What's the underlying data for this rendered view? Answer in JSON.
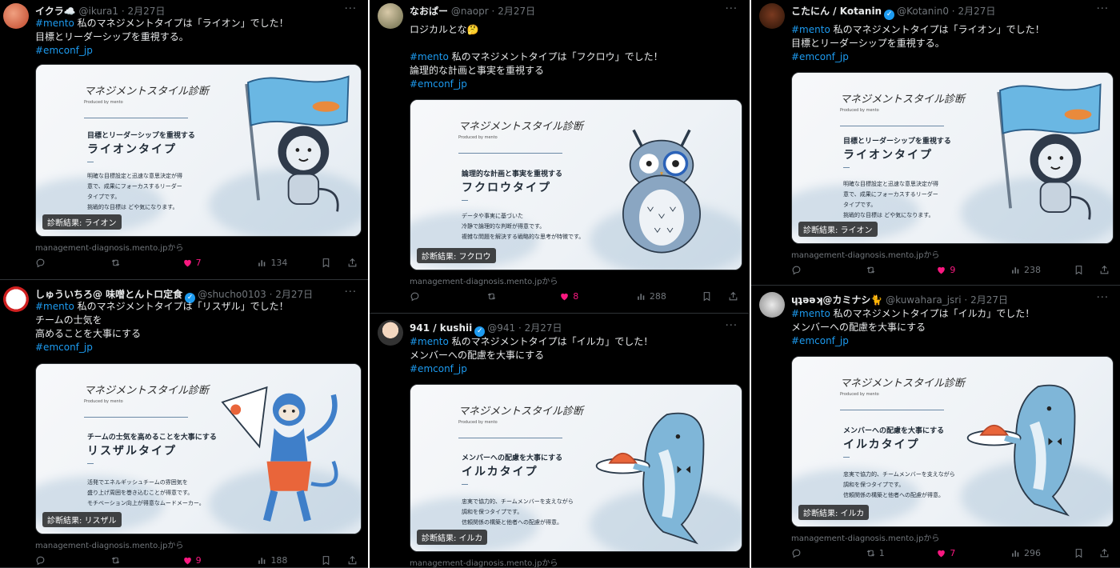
{
  "col1": [
    {
      "name": "イクラ☁️",
      "handle": "@ikura1",
      "date": "2月27日",
      "verified": false,
      "lines": [
        [
          {
            "t": "#mento",
            "h": true
          },
          {
            "t": " 私のマネジメントタイプは「ライオン」でした！",
            "h": false
          }
        ],
        [
          {
            "t": "目標とリーダーシップを重視する。",
            "h": false
          }
        ],
        [
          {
            "t": "#emconf_jp",
            "h": true
          }
        ]
      ],
      "card": {
        "logo": "マネジメントスタイル診断",
        "produced": "Produced by mento",
        "subtitle": "目標とリーダーシップを重視する",
        "type": "ライオンタイプ",
        "desc": [
          "明確な目標設定と迅速な意思決定が得",
          "意で、成果にフォーカスするリーダー",
          "タイプです。",
          "挑戦的な目標は どや気になります。"
        ],
        "badge": "診断結果: ライオン"
      },
      "link": "management-diagnosis.mento.jpから",
      "stats": {
        "reply": "",
        "retweet": "",
        "like": "7",
        "views": "134"
      }
    },
    {
      "name": "しゅういちろ@ 味噌とんトロ定食",
      "handle": "@shucho0103",
      "date": "2月27日",
      "verified": true,
      "lines": [
        [
          {
            "t": "#mento",
            "h": true
          },
          {
            "t": " 私のマネジメントタイプは「リスザル」でした！",
            "h": false
          }
        ],
        [
          {
            "t": "チームの士気を",
            "h": false
          }
        ],
        [
          {
            "t": "高めることを大事にする",
            "h": false
          }
        ],
        [
          {
            "t": "#emconf_jp",
            "h": true
          }
        ]
      ],
      "card": {
        "logo": "マネジメントスタイル診断",
        "produced": "Produced by mento",
        "subtitle": "チームの士気を高めることを大事にする",
        "type": "リスザルタイプ",
        "desc": [
          "活発でエネルギッシュチームの雰囲気を",
          "盛り上げ周囲を巻き込むことが得意です。",
          "モチベーション向上が得意なムードメーカー。"
        ],
        "badge": "診断結果: リスザル"
      },
      "link": "management-diagnosis.mento.jpから",
      "stats": {
        "reply": "",
        "retweet": "",
        "like": "9",
        "views": "188"
      }
    }
  ],
  "col2": [
    {
      "name": "なおぱー",
      "handle": "@naopr",
      "date": "2月27日",
      "verified": false,
      "lines": [
        [
          {
            "t": "ロジカルとな🤔",
            "h": false
          }
        ],
        [
          {
            "t": "",
            "h": false
          }
        ],
        [
          {
            "t": "#mento",
            "h": true
          },
          {
            "t": " 私のマネジメントタイプは「フクロウ」でした！",
            "h": false
          }
        ],
        [
          {
            "t": "論理的な計画と事実を重視する",
            "h": false
          }
        ],
        [
          {
            "t": "#emconf_jp",
            "h": true
          }
        ]
      ],
      "card": {
        "logo": "マネジメントスタイル診断",
        "produced": "Produced by mento",
        "subtitle": "論理的な計画と事実を重視する",
        "type": "フクロウタイプ",
        "desc": [
          "データや事実に基づいた",
          "冷静で論理的な判断が得意です。",
          "複雑な問題を解決する戦略的な思考が特徴です。"
        ],
        "badge": "診断結果: フクロウ"
      },
      "link": "management-diagnosis.mento.jpから",
      "stats": {
        "reply": "",
        "retweet": "",
        "like": "8",
        "views": "288"
      }
    },
    {
      "name": "941 / kushii",
      "handle": "@941",
      "date": "2月27日",
      "verified": true,
      "lines": [
        [
          {
            "t": "#mento",
            "h": true
          },
          {
            "t": " 私のマネジメントタイプは「イルカ」でした！",
            "h": false
          }
        ],
        [
          {
            "t": "メンバーへの配慮を大事にする",
            "h": false
          }
        ],
        [
          {
            "t": "#emconf_jp",
            "h": true
          }
        ]
      ],
      "card": {
        "logo": "マネジメントスタイル診断",
        "produced": "Produced by mento",
        "subtitle": "メンバーへの配慮を大事にする",
        "type": "イルカタイプ",
        "desc": [
          "忠実で協力的、チームメンバーを支えながら",
          "調和を保つタイプです。",
          "信頼関係の構築と他者への配慮が得意。"
        ],
        "badge": "診断結果: イルカ"
      },
      "link": "management-diagnosis.mento.jpから",
      "stats": {
        "reply": "",
        "retweet": "",
        "like": "",
        "views": ""
      }
    }
  ],
  "col3": [
    {
      "name": "こたにん / Kotanin",
      "handle": "@Kotanin0",
      "date": "2月27日",
      "verified": true,
      "lines": [
        [
          {
            "t": "#mento",
            "h": true
          },
          {
            "t": " 私のマネジメントタイプは「ライオン」でした！",
            "h": false
          }
        ],
        [
          {
            "t": "目標とリーダーシップを重視する。",
            "h": false
          }
        ],
        [
          {
            "t": "#emconf_jp",
            "h": true
          }
        ]
      ],
      "card": {
        "logo": "マネジメントスタイル診断",
        "produced": "Produced by mento",
        "subtitle": "目標とリーダーシップを重視する",
        "type": "ライオンタイプ",
        "desc": [
          "明確な目標設定と迅速な意思決定が得",
          "意で、成果にフォーカスするリーダー",
          "タイプです。",
          "挑戦的な目標は どや気になります。"
        ],
        "badge": "診断結果: ライオン"
      },
      "link": "management-diagnosis.mento.jpから",
      "stats": {
        "reply": "",
        "retweet": "",
        "like": "9",
        "views": "238"
      }
    },
    {
      "name": "ɥʇǝǝʞ@カミナシ🐈",
      "handle": "@kuwahara_jsri",
      "date": "2月27日",
      "verified": false,
      "lines": [
        [
          {
            "t": "#mento",
            "h": true
          },
          {
            "t": " 私のマネジメントタイプは「イルカ」でした！",
            "h": false
          }
        ],
        [
          {
            "t": "メンバーへの配慮を大事にする",
            "h": false
          }
        ],
        [
          {
            "t": "#emconf_jp",
            "h": true
          }
        ]
      ],
      "card": {
        "logo": "マネジメントスタイル診断",
        "produced": "Produced by mento",
        "subtitle": "メンバーへの配慮を大事にする",
        "type": "イルカタイプ",
        "desc": [
          "忠実で協力的、チームメンバーを支えながら",
          "調和を保つタイプです。",
          "信頼関係の構築と他者への配慮が得意。"
        ],
        "badge": "診断結果: イルカ"
      },
      "link": "management-diagnosis.mento.jpから",
      "stats": {
        "reply": "",
        "retweet": "1",
        "like": "7",
        "views": "296"
      }
    }
  ],
  "date_sep": "·",
  "more_label": "···",
  "colors": {
    "hashtag": "#1d9bf0",
    "like": "#f91880",
    "muted": "#71767b",
    "bg": "#000000"
  },
  "icons": [
    "reply-icon",
    "retweet-icon",
    "heart-icon",
    "views-icon",
    "bookmark-icon",
    "share-icon"
  ]
}
